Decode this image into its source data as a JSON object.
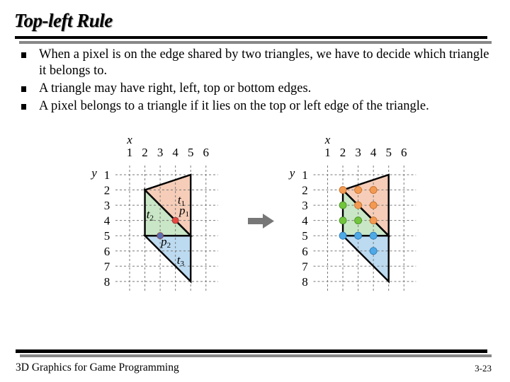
{
  "slide": {
    "title": "Top-left Rule",
    "bullets": [
      "When a pixel is on the edge shared by two triangles, we have to decide which triangle it belongs to.",
      "A triangle may have right, left, top or bottom edges.",
      "A pixel belongs to a triangle if it lies on the top or left edge of the triangle."
    ],
    "footer": {
      "course": "3D Graphics for Game Programming",
      "page": "3-23"
    }
  },
  "figure": {
    "x_axis_label": "x",
    "y_axis_label": "y",
    "x_ticks": [
      "1",
      "2",
      "3",
      "4",
      "5",
      "6"
    ],
    "y_ticks": [
      "1",
      "2",
      "3",
      "4",
      "5",
      "6",
      "7",
      "8"
    ],
    "colors": {
      "t1_fill": "#f6cdb8",
      "t2_fill": "#c9e6c6",
      "t3_fill": "#bcdaf0",
      "orange_dot": "#f39a52",
      "green_dot": "#72c53c",
      "blue_dot": "#4ea9e6",
      "p1_dot": "#e8483f",
      "p2_dot": "#5b6fb4",
      "arrow": "#777777"
    },
    "triangles": [
      {
        "name": "t1",
        "label": "t",
        "sub": "1",
        "vertices": [
          [
            2,
            2
          ],
          [
            5,
            1
          ],
          [
            5,
            5
          ]
        ]
      },
      {
        "name": "t2",
        "label": "t",
        "sub": "2",
        "vertices": [
          [
            2,
            2
          ],
          [
            5,
            5
          ],
          [
            2,
            5
          ]
        ]
      },
      {
        "name": "t3",
        "label": "t",
        "sub": "3",
        "vertices": [
          [
            2,
            5
          ],
          [
            5,
            5
          ],
          [
            5,
            8
          ]
        ]
      }
    ],
    "left_panel": {
      "points": [
        {
          "name": "p1",
          "label": "p",
          "sub": "1",
          "at": [
            4,
            4
          ]
        },
        {
          "name": "p2",
          "label": "p",
          "sub": "2",
          "at": [
            3,
            5
          ]
        }
      ]
    },
    "right_panel": {
      "pixels": [
        {
          "at": [
            2,
            2
          ],
          "owner": "t1"
        },
        {
          "at": [
            3,
            2
          ],
          "owner": "t1"
        },
        {
          "at": [
            4,
            2
          ],
          "owner": "t1"
        },
        {
          "at": [
            3,
            3
          ],
          "owner": "t1"
        },
        {
          "at": [
            4,
            3
          ],
          "owner": "t1"
        },
        {
          "at": [
            4,
            4
          ],
          "owner": "t1"
        },
        {
          "at": [
            2,
            3
          ],
          "owner": "t2"
        },
        {
          "at": [
            2,
            4
          ],
          "owner": "t2"
        },
        {
          "at": [
            3,
            4
          ],
          "owner": "t2"
        },
        {
          "at": [
            2,
            5
          ],
          "owner": "t3"
        },
        {
          "at": [
            3,
            5
          ],
          "owner": "t3"
        },
        {
          "at": [
            4,
            5
          ],
          "owner": "t3"
        },
        {
          "at": [
            4,
            6
          ],
          "owner": "t3"
        }
      ]
    }
  }
}
